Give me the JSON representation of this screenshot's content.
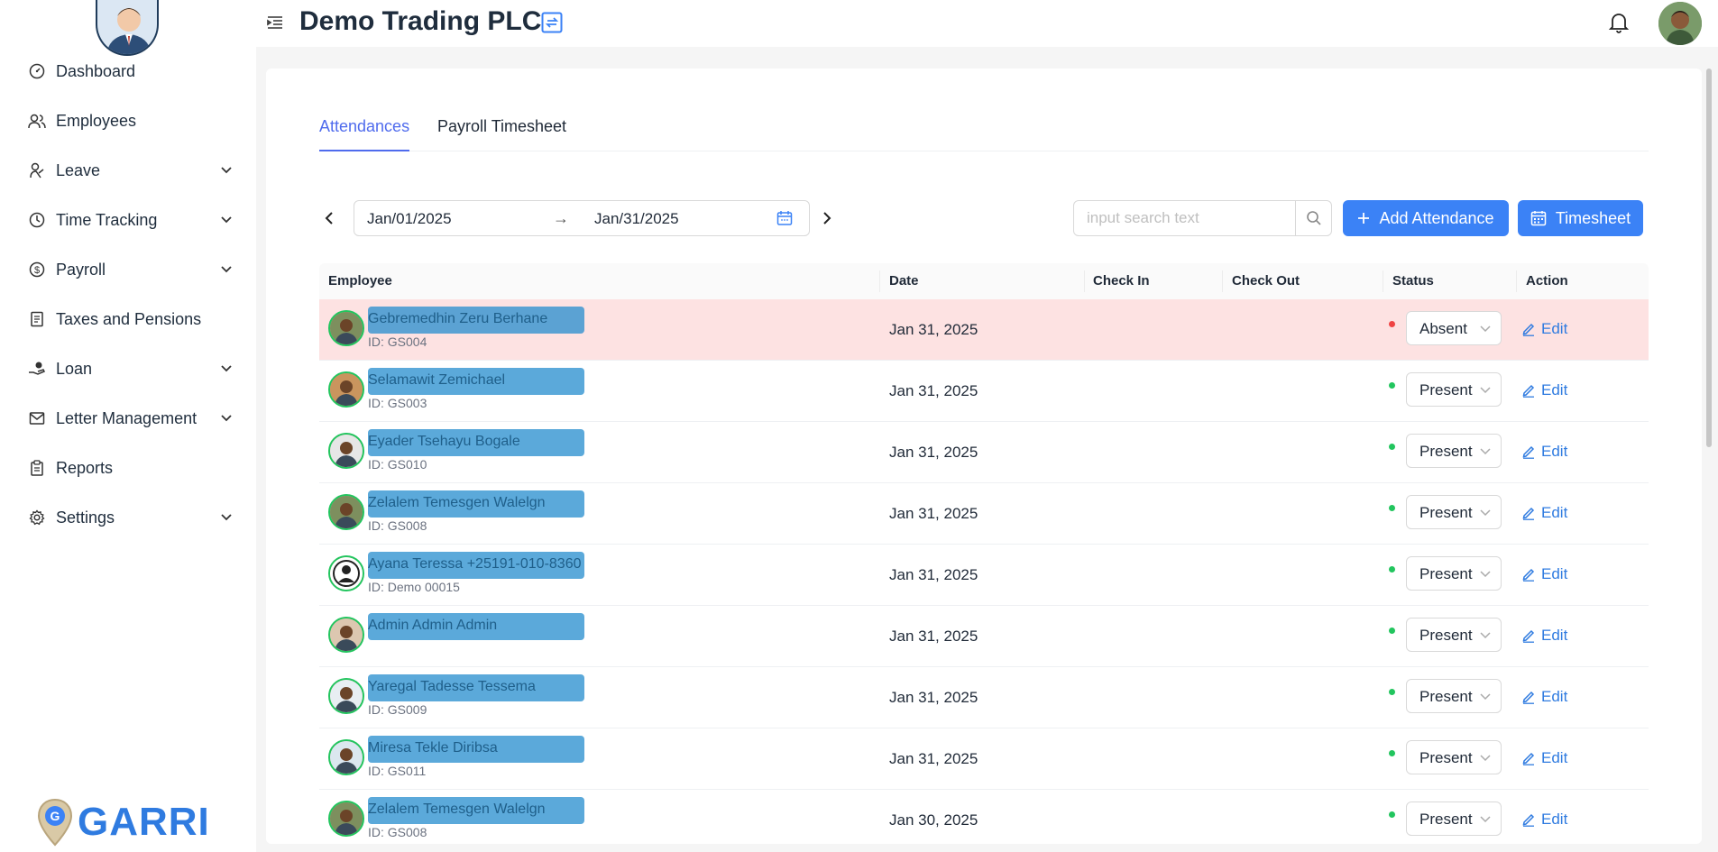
{
  "header": {
    "company": "Demo Trading PLC"
  },
  "sidebar": {
    "items": [
      {
        "label": "Dashboard",
        "icon": "dashboard-icon",
        "expandable": false
      },
      {
        "label": "Employees",
        "icon": "users-icon",
        "expandable": false
      },
      {
        "label": "Leave",
        "icon": "leave-icon",
        "expandable": true
      },
      {
        "label": "Time Tracking",
        "icon": "clock-icon",
        "expandable": true
      },
      {
        "label": "Payroll",
        "icon": "dollar-icon",
        "expandable": true
      },
      {
        "label": "Taxes and Pensions",
        "icon": "receipt-icon",
        "expandable": false
      },
      {
        "label": "Loan",
        "icon": "loan-icon",
        "expandable": true
      },
      {
        "label": "Letter Management",
        "icon": "mail-icon",
        "expandable": true
      },
      {
        "label": "Reports",
        "icon": "clipboard-icon",
        "expandable": false
      },
      {
        "label": "Settings",
        "icon": "gear-icon",
        "expandable": true
      }
    ],
    "brand": "GARRI"
  },
  "tabs": [
    {
      "label": "Attendances",
      "active": true
    },
    {
      "label": "Payroll Timesheet",
      "active": false
    }
  ],
  "toolbar": {
    "start_date": "Jan/01/2025",
    "end_date": "Jan/31/2025",
    "range_separator": "→",
    "search_placeholder": "input search text",
    "add_label": "Add Attendance",
    "timesheet_label": "Timesheet"
  },
  "table": {
    "columns": [
      "Employee",
      "Date",
      "Check In",
      "Check Out",
      "Status",
      "Action"
    ],
    "edit_label": "Edit",
    "rows": [
      {
        "name": "Gebremedhin Zeru Berhane",
        "id": "ID: GS004",
        "date": "Jan 31, 2025",
        "status": "Absent"
      },
      {
        "name": "Selamawit Zemichael",
        "id": "ID: GS003",
        "date": "Jan 31, 2025",
        "status": "Present"
      },
      {
        "name": "Eyader Tsehayu Bogale",
        "id": "ID: GS010",
        "date": "Jan 31, 2025",
        "status": "Present"
      },
      {
        "name": "Zelalem Temesgen Walelgn",
        "id": "ID: GS008",
        "date": "Jan 31, 2025",
        "status": "Present"
      },
      {
        "name": "Ayana Teressa +25191-010-8360",
        "id": "ID: Demo 00015",
        "date": "Jan 31, 2025",
        "status": "Present"
      },
      {
        "name": "Admin Admin Admin",
        "id": "",
        "date": "Jan 31, 2025",
        "status": "Present"
      },
      {
        "name": "Yaregal Tadesse Tessema",
        "id": "ID: GS009",
        "date": "Jan 31, 2025",
        "status": "Present"
      },
      {
        "name": "Miresa Tekle Diribsa",
        "id": "ID: GS011",
        "date": "Jan 31, 2025",
        "status": "Present"
      },
      {
        "name": "Zelalem Temesgen Walelgn",
        "id": "ID: GS008",
        "date": "Jan 30, 2025",
        "status": "Present"
      }
    ]
  },
  "colors": {
    "accent": "#3b82f6",
    "absent_row": "#fde2e2",
    "absent_dot": "#ef4444",
    "present_dot": "#22c55e"
  }
}
